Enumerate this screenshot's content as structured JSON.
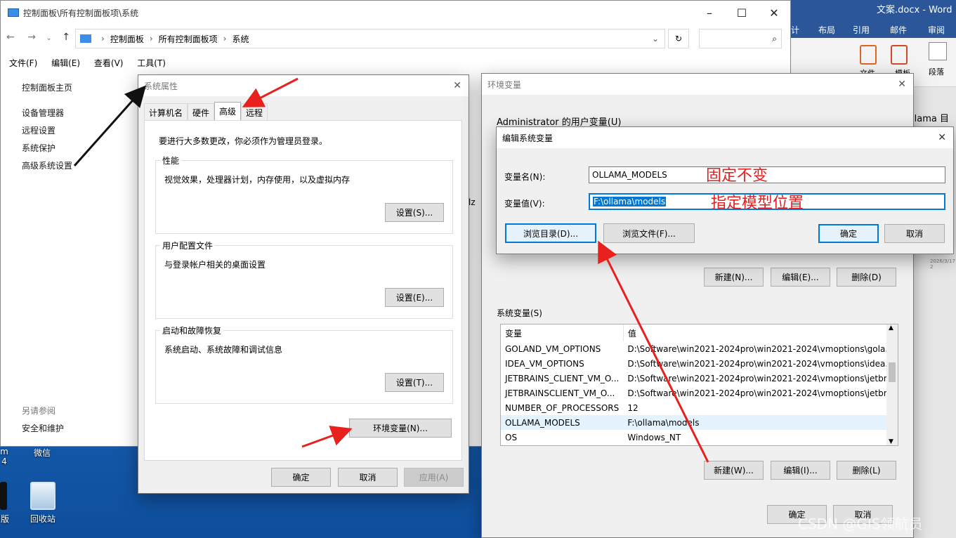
{
  "desktop": {
    "icons": [
      {
        "label": "微信"
      },
      {
        "label": "回收站"
      },
      {
        "label": "版"
      }
    ],
    "edge_text": {
      "line1": "m",
      "line2": "4"
    }
  },
  "word": {
    "title": "文案.docx  -  Word",
    "tabs": [
      "计",
      "布局",
      "引用",
      "邮件",
      "审阅"
    ],
    "ribbon_labels": [
      "文件",
      "模板",
      "段落"
    ],
    "doc_snippet": "llama 目录",
    "date_text": "2026/3/17 2"
  },
  "explorer": {
    "title": "控制面板\\所有控制面板项\\系统",
    "breadcrumb": [
      "控制面板",
      "所有控制面板项",
      "系统"
    ],
    "search_placeholder": "",
    "menu": [
      "文件(F)",
      "编辑(E)",
      "查看(V)",
      "工具(T)"
    ],
    "left_nav": {
      "home": "控制面板主页",
      "links": [
        "设备管理器",
        "远程设置",
        "系统保护",
        "高级系统设置"
      ],
      "see_also_title": "另请参阅",
      "see_also": [
        "安全和维护"
      ]
    },
    "hz_text": "lz"
  },
  "sysprops": {
    "title": "系统属性",
    "tabs": [
      "计算机名",
      "硬件",
      "高级",
      "远程"
    ],
    "active_tab": "高级",
    "admin_note": "要进行大多数更改，你必须作为管理员登录。",
    "performance": {
      "label": "性能",
      "desc": "视觉效果，处理器计划，内存使用，以及虚拟内存",
      "button": "设置(S)..."
    },
    "profile": {
      "label": "用户配置文件",
      "desc": "与登录帐户相关的桌面设置",
      "button": "设置(E)..."
    },
    "startup": {
      "label": "启动和故障恢复",
      "desc": "系统启动、系统故障和调试信息",
      "button": "设置(T)..."
    },
    "env_button": "环境变量(N)...",
    "ok": "确定",
    "cancel": "取消",
    "apply": "应用(A)"
  },
  "envvars": {
    "title": "环境变量",
    "user_section": "Administrator 的用户变量(U)",
    "user_buttons": {
      "new": "新建(N)...",
      "edit": "编辑(E)...",
      "delete": "删除(D)"
    },
    "sys_section": "系统变量(S)",
    "columns": [
      "变量",
      "值"
    ],
    "rows": [
      {
        "name": "GOLAND_VM_OPTIONS",
        "value": "D:\\Software\\win2021-2024pro\\win2021-2024\\vmoptions\\gola..."
      },
      {
        "name": "IDEA_VM_OPTIONS",
        "value": "D:\\Software\\win2021-2024pro\\win2021-2024\\vmoptions\\idea..."
      },
      {
        "name": "JETBRAINS_CLIENT_VM_O...",
        "value": "D:\\Software\\win2021-2024pro\\win2021-2024\\vmoptions\\jetbr..."
      },
      {
        "name": "JETBRAINSCLIENT_VM_O...",
        "value": "D:\\Software\\win2021-2024pro\\win2021-2024\\vmoptions\\jetbr..."
      },
      {
        "name": "NUMBER_OF_PROCESSORS",
        "value": "12"
      },
      {
        "name": "OLLAMA_MODELS",
        "value": "F:\\ollama\\models"
      },
      {
        "name": "OS",
        "value": "Windows_NT"
      }
    ],
    "selected_row": 5,
    "sys_buttons": {
      "new": "新建(W)...",
      "edit": "编辑(I)...",
      "delete": "删除(L)"
    },
    "ok": "确定",
    "cancel": "取消"
  },
  "editvar": {
    "title": "编辑系统变量",
    "name_label": "变量名(N):",
    "name_value": "OLLAMA_MODELS",
    "value_label": "变量值(V):",
    "value_value": "F:\\ollama\\models",
    "browse_dir": "浏览目录(D)...",
    "browse_file": "浏览文件(F)...",
    "ok": "确定",
    "cancel": "取消"
  },
  "annotations": {
    "note_name": "固定不变",
    "note_value": "指定模型位置",
    "watermark": "CSDN @GIS领航员",
    "arrow_color": "#e8201e"
  }
}
